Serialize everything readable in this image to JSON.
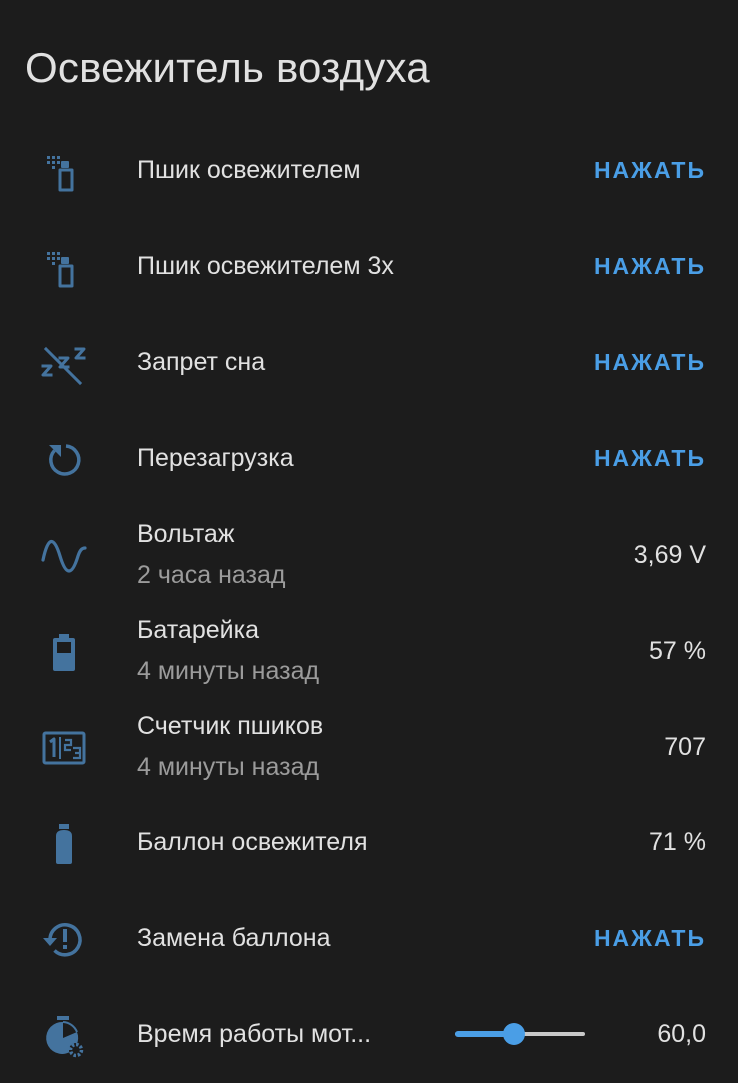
{
  "card": {
    "title": "Освежитель воздуха"
  },
  "entities": [
    {
      "name": "Пшик освежителем",
      "icon": "spray-bottle-icon",
      "action": "НАЖАТЬ"
    },
    {
      "name": "Пшик освежителем 3x",
      "icon": "spray-bottle-icon",
      "action": "НАЖАТЬ"
    },
    {
      "name": "Запрет сна",
      "icon": "sleep-off-icon",
      "action": "НАЖАТЬ"
    },
    {
      "name": "Перезагрузка",
      "icon": "restart-icon",
      "action": "НАЖАТЬ"
    },
    {
      "name": "Вольтаж",
      "secondary": "2 часа назад",
      "icon": "sine-wave-icon",
      "value": "3,69 V"
    },
    {
      "name": "Батарейка",
      "secondary": "4 минуты назад",
      "icon": "battery-icon",
      "value": "57 %"
    },
    {
      "name": "Счетчик пшиков",
      "secondary": "4 минуты назад",
      "icon": "counter-icon",
      "value": "707"
    },
    {
      "name": "Баллон освежителя",
      "icon": "gas-cylinder-icon",
      "value": "71 %"
    },
    {
      "name": "Замена баллона",
      "icon": "history-alert-icon",
      "action": "НАЖАТЬ"
    },
    {
      "name": "Время работы мот...",
      "icon": "timer-cog-icon",
      "value": "60,0",
      "slider_fraction": 0.45
    }
  ],
  "colors": {
    "background": "#1c1c1c",
    "icon": "#44739e",
    "accent": "#4a9ee6",
    "primary_text": "#e1e1e1",
    "secondary_text": "#9b9b9b"
  }
}
